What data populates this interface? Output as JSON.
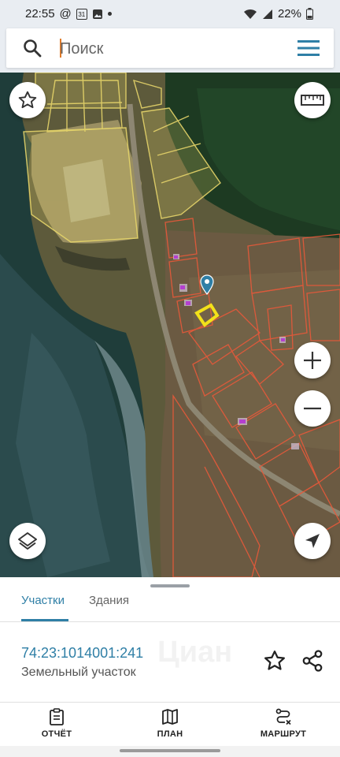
{
  "status_bar": {
    "time": "22:55",
    "at_symbol": "@",
    "calendar_day": "31",
    "battery": "22%"
  },
  "search": {
    "placeholder": "Поиск",
    "value": ""
  },
  "tabs": [
    {
      "label": "Участки",
      "active": true
    },
    {
      "label": "Здания",
      "active": false
    }
  ],
  "parcel": {
    "cadastral_number": "74:23:1014001:241",
    "type": "Земельный участок"
  },
  "watermark": "Циан",
  "bottom_nav": [
    {
      "label": "ОТЧЁТ",
      "icon": "report-clipboard-icon"
    },
    {
      "label": "ПЛАН",
      "icon": "map-plan-icon"
    },
    {
      "label": "МАРШРУТ",
      "icon": "route-icon"
    }
  ],
  "colors": {
    "accent": "#2f7fa6",
    "selected_parcel": "#f3e11a",
    "parcel_outline_red": "#e8593a",
    "parcel_outline_yellow": "#e6d56a",
    "marker": "#2f7fa6"
  }
}
